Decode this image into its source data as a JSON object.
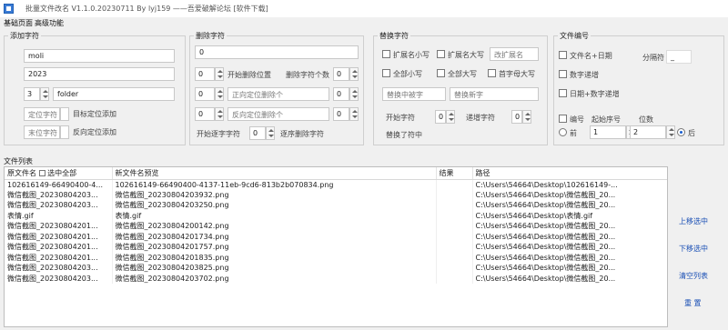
{
  "window": {
    "title": "批量文件改名 V1.1.0.20230711 By lyj159 ——吾爱破解论坛 [软件下载]"
  },
  "menu": {
    "items": [
      "基础页面",
      "高级功能"
    ]
  },
  "add_chars": {
    "legend": "添加字符",
    "prefix": "moli",
    "year": "2023",
    "seq_start": "3",
    "hint": "folder",
    "pos_label": "定位字符",
    "pos_right": "目标定位添加",
    "tail_label": "末位字符",
    "tail_right": "反向定位添加"
  },
  "delete_chars": {
    "legend": "删除字符",
    "field1": "0",
    "row2_num": "0",
    "row2_label": "开始删除位置",
    "row2_right": "删除字符个数",
    "row2_right_num": "0",
    "row3_num": "0",
    "row3_label": "正向定位删除个",
    "row3_right_num": "0",
    "row4_num": "0",
    "row4_label": "反向定位删除个",
    "row4_right_num": "0",
    "row5_label": "开始逐字字符",
    "row5_num": "0",
    "row5_right": "逐序删除字符"
  },
  "replace_chars": {
    "legend": "替换字符",
    "chk1": "扩展名小写",
    "chk2": "扩展名大写",
    "field_ext": "改扩展名",
    "chk3": "全部小写",
    "chk4": "全部大写",
    "chk5": "首字母大写",
    "from_label": "替换中被字",
    "to_label": "替换新字",
    "start_label": "开始字符",
    "start_num": "0",
    "step_label": "递增字符",
    "step_num": "0",
    "repl_label": "替换了符中"
  },
  "file_number": {
    "legend": "文件编号",
    "chk1": "文件名+日期",
    "sep_label": "分隔符",
    "sep_value": "_",
    "chk2": "数字递增",
    "chk3": "日期+数字递增",
    "num_label": "编号",
    "start_label": "起始序号",
    "digits_label": "位数",
    "start_value": "1",
    "digits_value": "2",
    "radio_front": "前",
    "radio_back": "后"
  },
  "file_list": {
    "label": "文件列表",
    "columns": [
      "原文件名",
      "新文件名预览",
      "结果",
      "路径"
    ],
    "select_all": "选中全部",
    "rows": [
      [
        "102616149-66490400-4...",
        "102616149-66490400-4137-11eb-9cd6-813b2b070834.png",
        "",
        "C:\\Users\\54664\\Desktop\\102616149-..."
      ],
      [
        "微信截图_20230804203...",
        "微信截图_20230804203932.png",
        "",
        "C:\\Users\\54664\\Desktop\\微信截图_20..."
      ],
      [
        "微信截图_20230804203...",
        "微信截图_20230804203250.png",
        "",
        "C:\\Users\\54664\\Desktop\\微信截图_20..."
      ],
      [
        "表情.gif",
        "表情.gif",
        "",
        "C:\\Users\\54664\\Desktop\\表情.gif"
      ],
      [
        "微信截图_20230804201...",
        "微信截图_20230804200142.png",
        "",
        "C:\\Users\\54664\\Desktop\\微信截图_20..."
      ],
      [
        "微信截图_20230804201...",
        "微信截图_20230804201734.png",
        "",
        "C:\\Users\\54664\\Desktop\\微信截图_20..."
      ],
      [
        "微信截图_20230804201...",
        "微信截图_20230804201757.png",
        "",
        "C:\\Users\\54664\\Desktop\\微信截图_20..."
      ],
      [
        "微信截图_20230804201...",
        "微信截图_20230804201835.png",
        "",
        "C:\\Users\\54664\\Desktop\\微信截图_20..."
      ],
      [
        "微信截图_20230804203...",
        "微信截图_20230804203825.png",
        "",
        "C:\\Users\\54664\\Desktop\\微信截图_20..."
      ],
      [
        "微信截图_20230804203...",
        "微信截图_20230804203702.png",
        "",
        "C:\\Users\\54664\\Desktop\\微信截图_20..."
      ]
    ]
  },
  "side_actions": {
    "move_up": "上移选中",
    "move_down": "下移选中",
    "clear": "清空列表",
    "reset": "重 置"
  },
  "colors": {
    "link": "#1a4fb5",
    "accent": "#1a5fd0"
  }
}
